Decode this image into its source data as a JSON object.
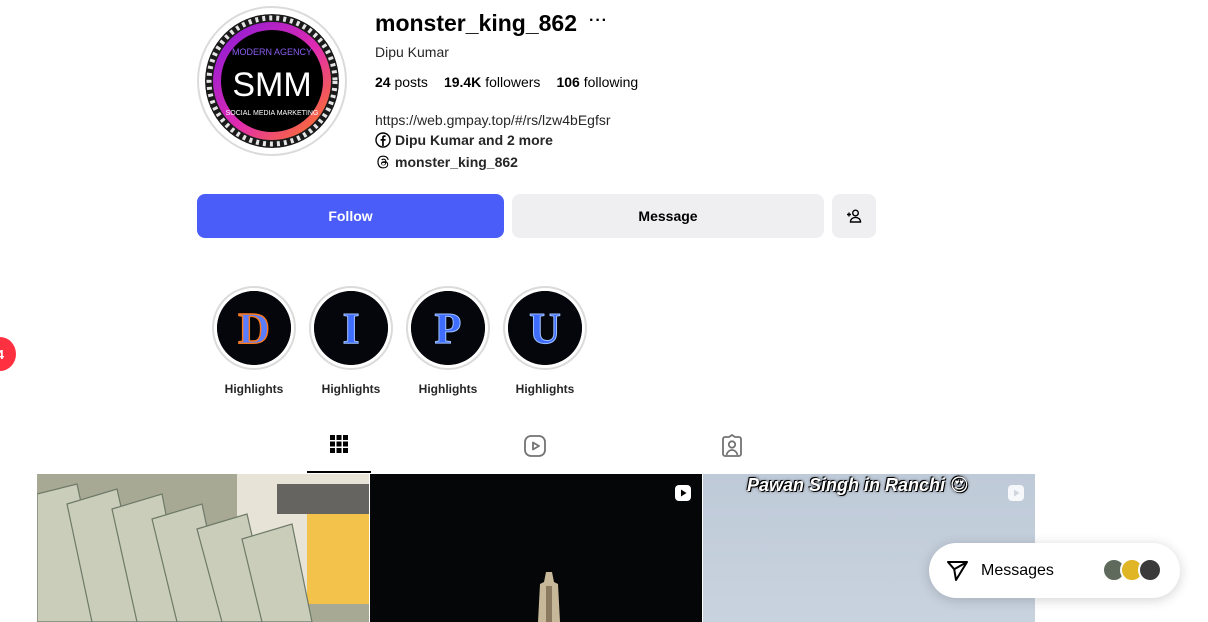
{
  "notification": {
    "count": "4"
  },
  "profile": {
    "avatar_text_top": "MODERN AGENCY",
    "avatar_text_main": "SMM",
    "avatar_text_bottom": "SOCIAL MEDIA MARKETING",
    "username": "monster_king_862",
    "more_label": "···",
    "full_name": "Dipu Kumar",
    "stats": {
      "posts_value": "24",
      "posts_label": "posts",
      "followers_value": "19.4K",
      "followers_label": "followers",
      "following_value": "106",
      "following_label": "following"
    },
    "link": "https://web.gmpay.top/#/rs/lzw4bEgfsr",
    "facebook_text": "Dipu Kumar and 2 more",
    "threads_text": "monster_king_862"
  },
  "actions": {
    "follow_label": "Follow",
    "message_label": "Message",
    "add_icon": "person-add-icon"
  },
  "highlights": [
    {
      "label": "Highlights",
      "letter": "D"
    },
    {
      "label": "Highlights",
      "letter": "I"
    },
    {
      "label": "Highlights",
      "letter": "P"
    },
    {
      "label": "Highlights",
      "letter": "U"
    }
  ],
  "tabs": [
    {
      "icon": "grid-icon",
      "active": true
    },
    {
      "icon": "reels-icon",
      "active": false
    },
    {
      "icon": "tagged-icon",
      "active": false
    }
  ],
  "posts": [
    {
      "type": "image",
      "caption": ""
    },
    {
      "type": "reel",
      "caption": ""
    },
    {
      "type": "reel",
      "caption": "Pawan Singh in Ranchi 😍"
    }
  ],
  "messages": {
    "label": "Messages",
    "icon": "send-icon"
  },
  "colors": {
    "accent": "#4a5df9",
    "button_bg": "#efeff2",
    "notification": "#ff3040"
  }
}
